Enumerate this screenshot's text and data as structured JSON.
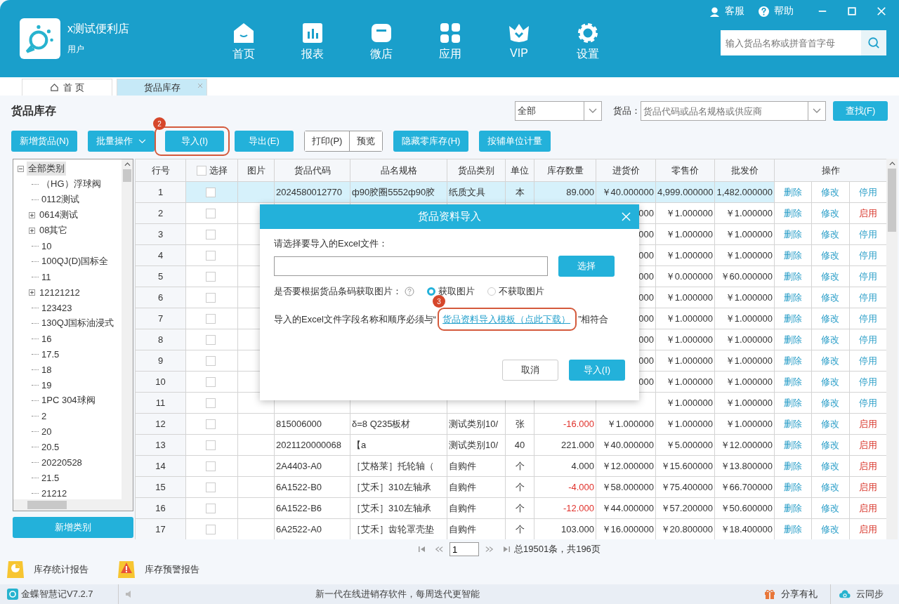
{
  "app": {
    "shop_name": "x测试便利店",
    "user_role": "用户"
  },
  "nav": [
    {
      "label": "首页",
      "kind": "home"
    },
    {
      "label": "报表",
      "kind": "report"
    },
    {
      "label": "微店",
      "kind": "shop"
    },
    {
      "label": "应用",
      "kind": "apps"
    },
    {
      "label": "VIP",
      "kind": "vip"
    },
    {
      "label": "设置",
      "kind": "settings"
    }
  ],
  "top_links": [
    {
      "label": "客服",
      "kind": "service"
    },
    {
      "label": "帮助",
      "kind": "help"
    }
  ],
  "search": {
    "placeholder": "输入货品名称或拼音首字母"
  },
  "tabs": [
    {
      "label": "首 页",
      "selected": false,
      "closable": false
    },
    {
      "label": "货品库存",
      "selected": true,
      "closable": true
    }
  ],
  "page_title": "货品库存",
  "filter": {
    "category": "全部",
    "goods_label": "货品：",
    "goods_placeholder": "货品代码或品名规格或供应商",
    "find_button": "查找(F)"
  },
  "toolbar": [
    {
      "kind": "button",
      "label": "新增货品(N)"
    },
    {
      "kind": "dropdown",
      "label": "批量操作"
    },
    {
      "kind": "button",
      "label": "导入(I)",
      "step": "2"
    },
    {
      "kind": "button",
      "label": "导出(E)"
    },
    {
      "kind": "pair",
      "items": [
        "打印(P)",
        "预览"
      ]
    },
    {
      "kind": "button",
      "label": "隐藏零库存(H)"
    },
    {
      "kind": "button",
      "label": "按辅单位计量"
    }
  ],
  "category_tree": {
    "label": "全部类别",
    "expanded": true,
    "selected": true,
    "children": [
      {
        "label": "（HG）浮球阀",
        "kind": "leaf"
      },
      {
        "label": "0112测试",
        "kind": "leaf"
      },
      {
        "label": "0614测试",
        "kind": "group",
        "expanded": false
      },
      {
        "label": "08其它",
        "kind": "group",
        "expanded": false
      },
      {
        "label": "10",
        "kind": "leaf"
      },
      {
        "label": "100QJ(D)国标全",
        "kind": "leaf"
      },
      {
        "label": "11",
        "kind": "leaf"
      },
      {
        "label": "12121212",
        "kind": "group",
        "expanded": false
      },
      {
        "label": "123423",
        "kind": "leaf"
      },
      {
        "label": "130QJ国标油浸式",
        "kind": "leaf"
      },
      {
        "label": "16",
        "kind": "leaf"
      },
      {
        "label": "17.5",
        "kind": "leaf"
      },
      {
        "label": "18",
        "kind": "leaf"
      },
      {
        "label": "19",
        "kind": "leaf"
      },
      {
        "label": "1PC 304球阀",
        "kind": "leaf"
      },
      {
        "label": "2",
        "kind": "leaf"
      },
      {
        "label": "20",
        "kind": "leaf"
      },
      {
        "label": "20.5",
        "kind": "leaf"
      },
      {
        "label": "20220528",
        "kind": "leaf"
      },
      {
        "label": "21.5",
        "kind": "leaf"
      },
      {
        "label": "21212",
        "kind": "leaf"
      }
    ]
  },
  "add_category_button": "新增类别",
  "table": {
    "columns": [
      "行号",
      "选择",
      "图片",
      "货品代码",
      "品名规格",
      "货品类别",
      "单位",
      "库存数量",
      "进货价",
      "零售价",
      "批发价",
      "操作"
    ],
    "header_checked": false,
    "rows": [
      {
        "no": "1",
        "selected": true,
        "checked": false,
        "code": "2024580012770",
        "name": "ф90胶圈5552ф90胶",
        "category": "纸质文具",
        "unit": "本",
        "qty": "89.000",
        "negative": false,
        "purchase": "￥40.000000",
        "retail": "4,999.000000",
        "wholesale": "1,482.000000",
        "actions": [
          "删除",
          "修改"
        ],
        "toggle": "停用",
        "inactive": false
      },
      {
        "no": "2",
        "selected": false,
        "checked": false,
        "purchase": "000",
        "retail": "￥1.000000",
        "wholesale": "￥1.000000",
        "actions": [
          "删除",
          "修改"
        ],
        "toggle": "启用",
        "inactive": true
      },
      {
        "no": "3",
        "selected": false,
        "checked": false,
        "purchase": "000",
        "retail": "￥1.000000",
        "wholesale": "￥1.000000",
        "actions": [
          "删除",
          "修改"
        ],
        "toggle": "停用",
        "inactive": false
      },
      {
        "no": "4",
        "selected": false,
        "checked": false,
        "purchase": "000",
        "retail": "￥1.000000",
        "wholesale": "￥1.000000",
        "actions": [
          "删除",
          "修改"
        ],
        "toggle": "停用",
        "inactive": false
      },
      {
        "no": "5",
        "selected": false,
        "checked": false,
        "purchase": "000",
        "retail": "￥0.000000",
        "wholesale": "￥60.000000",
        "actions": [
          "删除",
          "修改"
        ],
        "toggle": "停用",
        "inactive": false
      },
      {
        "no": "6",
        "selected": false,
        "checked": false,
        "purchase": "000",
        "retail": "￥1.000000",
        "wholesale": "￥1.000000",
        "actions": [
          "删除",
          "修改"
        ],
        "toggle": "停用",
        "inactive": false
      },
      {
        "no": "7",
        "selected": false,
        "checked": false,
        "purchase": "000",
        "retail": "￥1.000000",
        "wholesale": "￥1.000000",
        "actions": [
          "删除",
          "修改"
        ],
        "toggle": "停用",
        "inactive": false
      },
      {
        "no": "8",
        "selected": false,
        "checked": false,
        "purchase": "000",
        "retail": "￥1.000000",
        "wholesale": "￥1.000000",
        "actions": [
          "删除",
          "修改"
        ],
        "toggle": "停用",
        "inactive": false
      },
      {
        "no": "9",
        "selected": false,
        "checked": false,
        "purchase": "000",
        "retail": "￥1.000000",
        "wholesale": "￥1.000000",
        "actions": [
          "删除",
          "修改"
        ],
        "toggle": "停用",
        "inactive": false
      },
      {
        "no": "10",
        "selected": false,
        "checked": false,
        "purchase": "000",
        "retail": "￥1.000000",
        "wholesale": "￥1.000000",
        "actions": [
          "删除",
          "修改"
        ],
        "toggle": "停用",
        "inactive": false
      },
      {
        "no": "11",
        "selected": false,
        "checked": false,
        "retail": "￥1.000000",
        "wholesale": "￥1.000000",
        "actions": [
          "删除",
          "修改"
        ],
        "toggle": "停用",
        "inactive": false
      },
      {
        "no": "12",
        "selected": false,
        "checked": false,
        "code": "815006000",
        "name": "δ=8 Q235板材",
        "category": "测试类别10/",
        "unit": "张",
        "qty": "-16.000",
        "negative": true,
        "purchase": "￥1.000000",
        "retail": "￥1.000000",
        "wholesale": "￥1.000000",
        "actions": [
          "删除",
          "修改"
        ],
        "toggle": "启用",
        "inactive": true
      },
      {
        "no": "13",
        "selected": false,
        "checked": false,
        "code": "2021120000068",
        "name": "【a",
        "category": "测试类别10/",
        "unit": "40",
        "qty": "221.000",
        "negative": false,
        "purchase": "￥40.000000",
        "retail": "￥5.000000",
        "wholesale": "￥12.000000",
        "actions": [
          "删除",
          "修改"
        ],
        "toggle": "启用",
        "inactive": true
      },
      {
        "no": "14",
        "selected": false,
        "checked": false,
        "code": "2A4403-A0",
        "name": "［艾格莱］托轮轴（",
        "category": "自购件",
        "unit": "个",
        "qty": "4.000",
        "negative": false,
        "purchase": "￥12.000000",
        "retail": "￥15.600000",
        "wholesale": "￥13.800000",
        "actions": [
          "删除",
          "修改"
        ],
        "toggle": "启用",
        "inactive": true
      },
      {
        "no": "15",
        "selected": false,
        "checked": false,
        "code": "6A1522-B0",
        "name": "［艾禾］310左轴承",
        "category": "自购件",
        "unit": "个",
        "qty": "-4.000",
        "negative": true,
        "purchase": "￥58.000000",
        "retail": "￥75.400000",
        "wholesale": "￥66.700000",
        "actions": [
          "删除",
          "修改"
        ],
        "toggle": "启用",
        "inactive": true
      },
      {
        "no": "16",
        "selected": false,
        "checked": false,
        "code": "6A1522-B6",
        "name": "［艾禾］310左轴承",
        "category": "自购件",
        "unit": "个",
        "qty": "-12.000",
        "negative": true,
        "purchase": "￥44.000000",
        "retail": "￥57.200000",
        "wholesale": "￥50.600000",
        "actions": [
          "删除",
          "修改"
        ],
        "toggle": "启用",
        "inactive": true
      },
      {
        "no": "17",
        "selected": false,
        "checked": false,
        "code": "6A2522-A0",
        "name": "［艾禾］齿轮罩壳垫",
        "category": "自购件",
        "unit": "个",
        "qty": "103.000",
        "negative": false,
        "purchase": "￥16.000000",
        "retail": "￥20.800000",
        "wholesale": "￥18.400000",
        "actions": [
          "删除",
          "修改"
        ],
        "toggle": "启用",
        "inactive": true
      }
    ]
  },
  "pagination": {
    "page": "1",
    "summary": "总19501条，共196页"
  },
  "reports": [
    {
      "label": "库存统计报告",
      "kind": "stats"
    },
    {
      "label": "库存预警报告",
      "kind": "warning"
    }
  ],
  "status_bar": {
    "version": "金蝶智慧记V7.2.7",
    "slogan": "新一代在线进销存软件，每周迭代更智能",
    "share": "分享有礼",
    "sync": "云同步"
  },
  "dialog": {
    "title": "货品资料导入",
    "file_label": "请选择要导入的Excel文件：",
    "choose_button": "选择",
    "image_question": "是否要根据货品条码获取图片：",
    "radios": [
      {
        "label": "获取图片",
        "selected": true
      },
      {
        "label": "不获取图片",
        "selected": false
      }
    ],
    "note": {
      "before": "导入的Excel文件字段名称和顺序必须与“",
      "link": "货品资料导入模板（点此下载）",
      "after": "”相符合",
      "step": "3"
    },
    "buttons": [
      {
        "label": "取消",
        "kind": "secondary"
      },
      {
        "label": "导入(I)",
        "kind": "primary"
      }
    ]
  }
}
